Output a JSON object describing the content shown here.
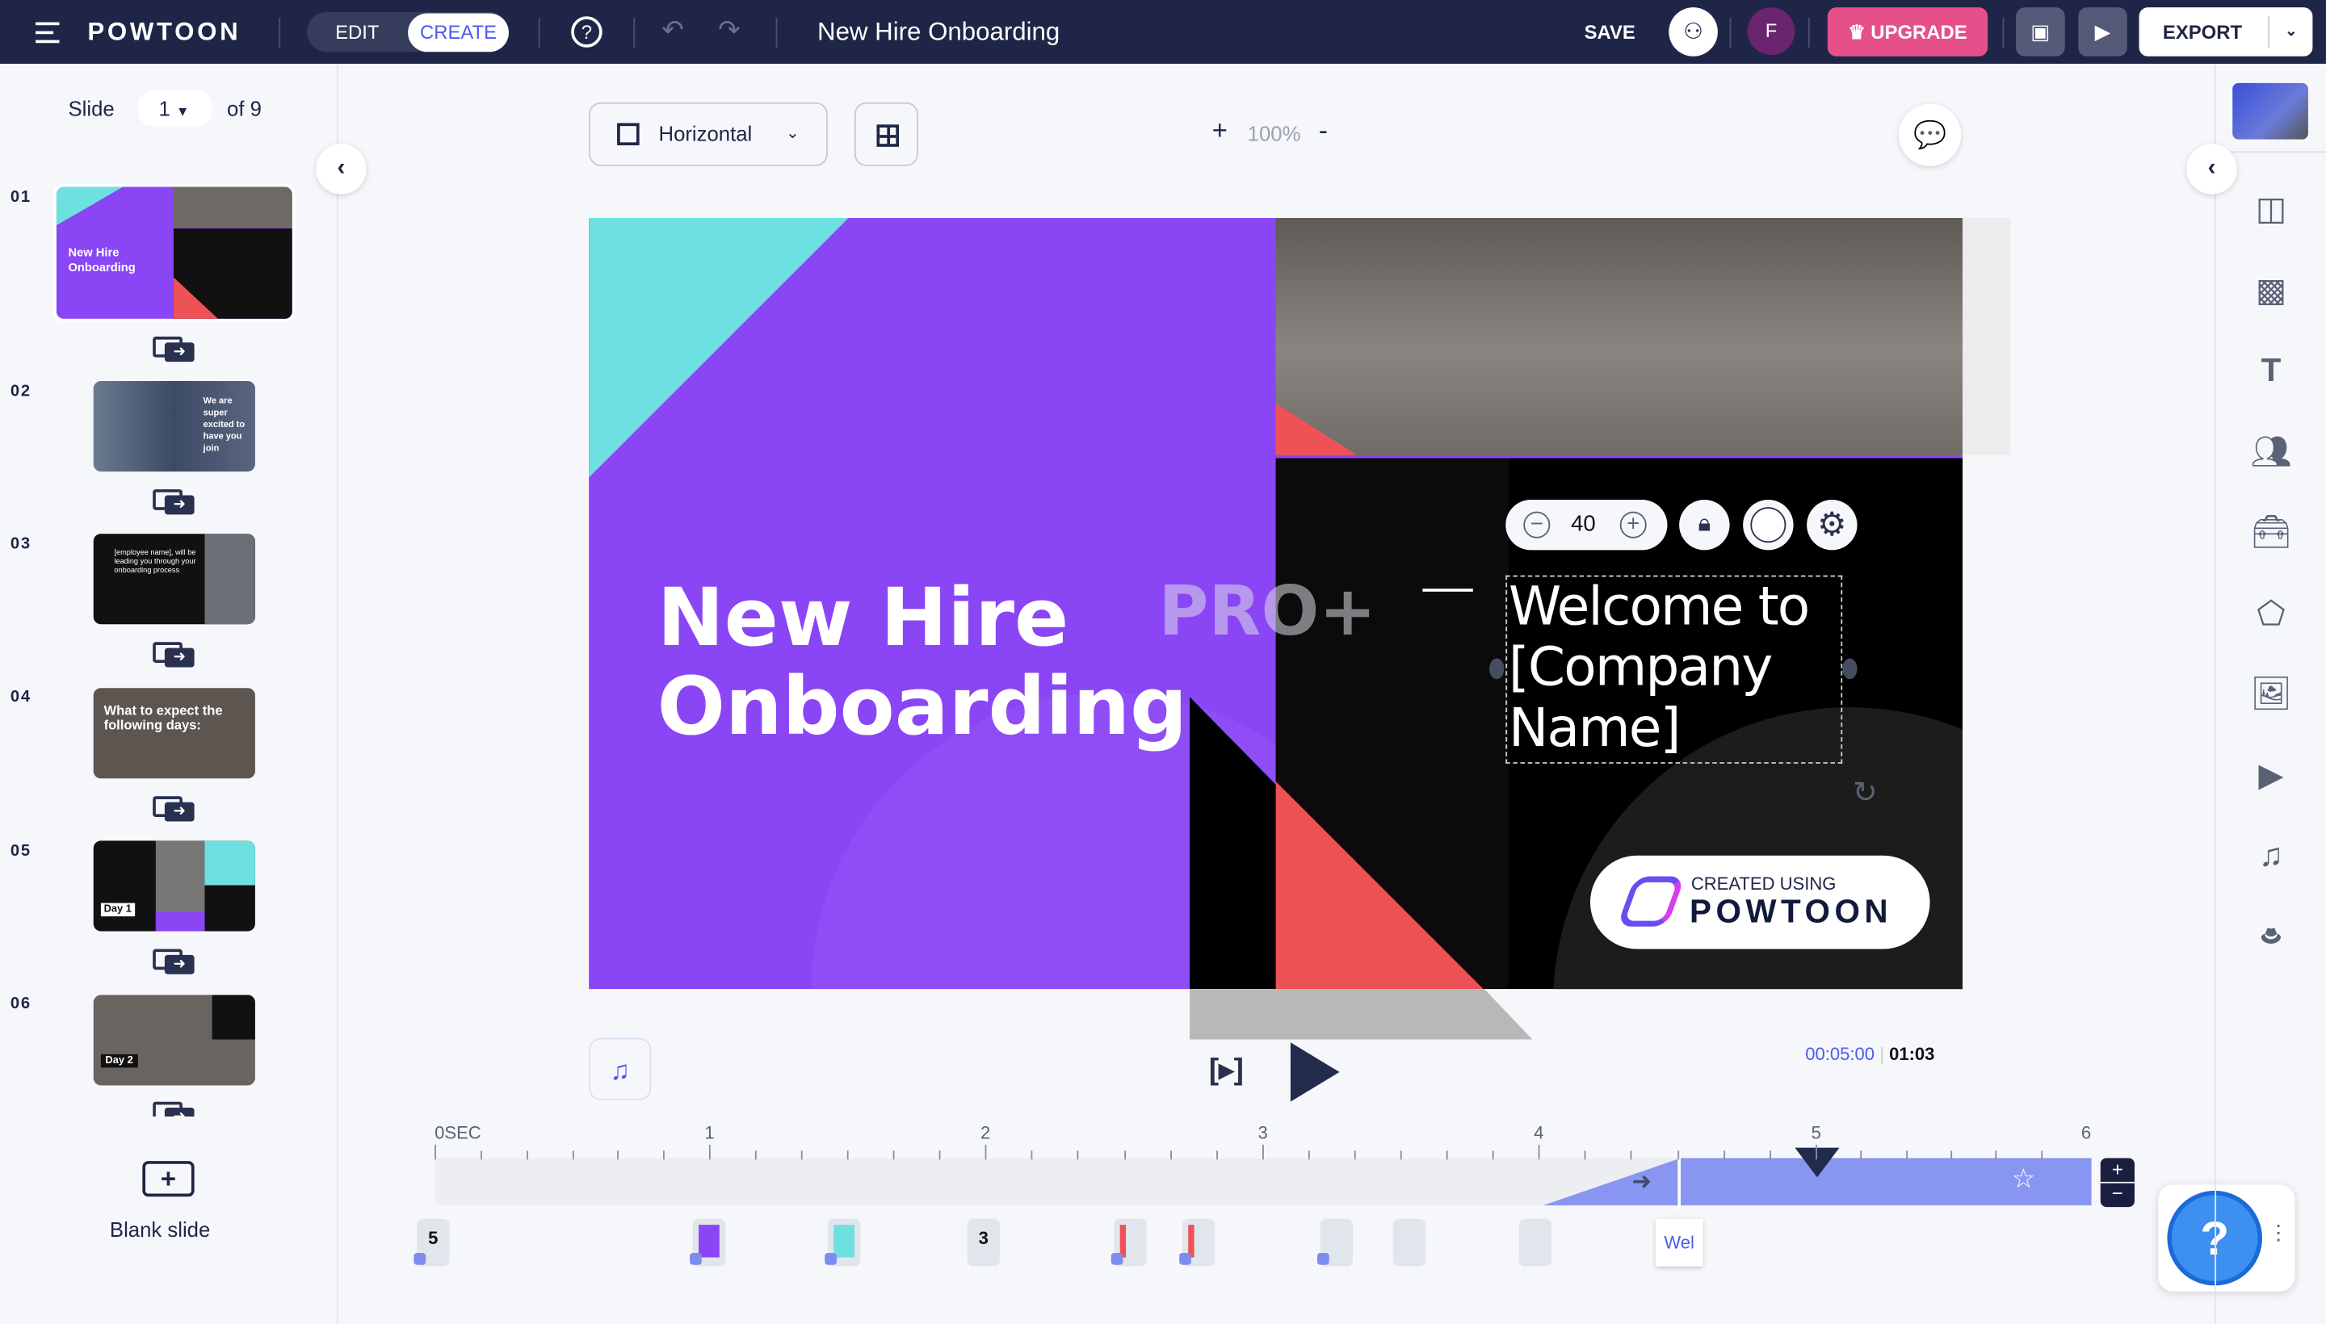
{
  "header": {
    "brand": "POWTOON",
    "mode_edit": "EDIT",
    "mode_create": "CREATE",
    "title": "New Hire Onboarding",
    "save": "SAVE",
    "avatar_initial": "F",
    "upgrade": "UPGRADE",
    "export": "EXPORT"
  },
  "slides_panel": {
    "slide_label": "Slide",
    "current": "1",
    "of": "of 9",
    "slides": [
      {
        "num": "01",
        "text": "New Hire Onboarding"
      },
      {
        "num": "02",
        "text": "We are super excited to have you join"
      },
      {
        "num": "03",
        "text": "[employee name], will be leading you through your onboarding process"
      },
      {
        "num": "04",
        "text": "What to expect the following days:"
      },
      {
        "num": "05",
        "text": "Day 1"
      },
      {
        "num": "06",
        "text": "Day 2"
      }
    ],
    "blank_slide": "Blank slide"
  },
  "canvas_toolbar": {
    "orientation": "Horizontal",
    "zoom": "100%"
  },
  "slide": {
    "title_line1": "New Hire",
    "title_line2": "Onboarding",
    "watermark": "PRO+",
    "welcome": "Welcome to [Company Name]",
    "badge_top": "CREATED USING",
    "badge_brand": "POWTOON",
    "text_toolbar": {
      "font_size": "40"
    },
    "colors": {
      "purple": "#8a45f5",
      "cyan": "#6ee0e0",
      "red": "#ee5257",
      "black": "#000000"
    }
  },
  "playback": {
    "current_time": "00:05:00",
    "total_time": "01:03"
  },
  "timeline": {
    "labels": [
      "0SEC",
      "1",
      "2",
      "3",
      "4",
      "5",
      "6"
    ],
    "markers": [
      "5",
      "",
      "",
      "3",
      "",
      "",
      "",
      "",
      "",
      ""
    ],
    "active_marker": "Wel"
  },
  "help": "?",
  "colors": {
    "topbar": "#1f2547",
    "accent": "#4a5cf0",
    "upgrade": "#e5508a",
    "timeline_fill": "#8896f2"
  }
}
